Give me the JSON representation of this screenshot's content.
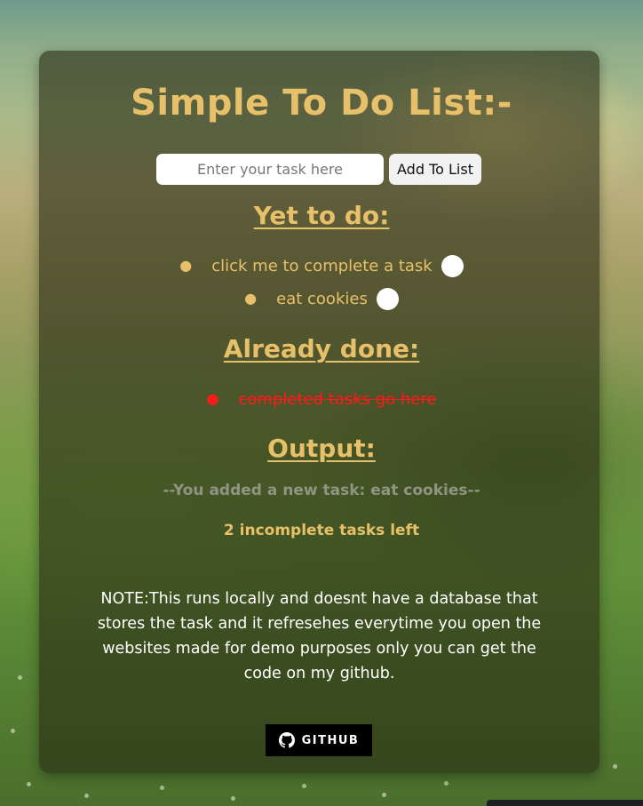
{
  "page": {
    "title": "Simple To Do List:-"
  },
  "add_form": {
    "input_placeholder": "Enter your task here",
    "input_value": "",
    "button_label": "Add To List"
  },
  "todo_section": {
    "heading": "Yet to do:",
    "tasks": [
      {
        "text": "click me to complete a task"
      },
      {
        "text": "eat cookies"
      }
    ]
  },
  "done_section": {
    "heading": "Already done:",
    "tasks": [
      {
        "text": "completed tasks go here"
      }
    ]
  },
  "output_section": {
    "heading": "Output:",
    "message": "--You added a new task: eat cookies--",
    "remaining": "2 incomplete tasks left"
  },
  "note": {
    "text": "NOTE:This runs locally and doesnt have a database that stores the task and it refresehes everytime you open the websites made for demo purposes only you can get the code on my github."
  },
  "github_button": {
    "label": "GITHUB",
    "icon": "github-icon"
  },
  "colors": {
    "accent_gold": "#e8c06a",
    "done_red": "#ff1a1a",
    "output_gray": "#8f9582",
    "card_bg": "rgba(40,44,20,0.62)"
  }
}
